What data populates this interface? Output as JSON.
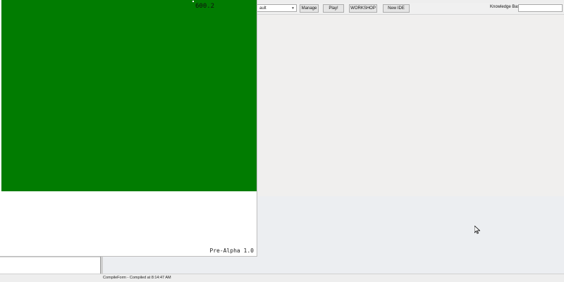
{
  "toolbar": {
    "combo_value": "ault",
    "manage_label": "Manage",
    "play_label": "Play!",
    "workshop_label": "WORKSHOP",
    "new_ide_label": "New IDE",
    "kb_label": "Knowledge Base:",
    "kb_value": ""
  },
  "game": {
    "score": "600.2",
    "version": "Pre-Alpha 1.0",
    "canvas_color": "#017c01"
  },
  "status": {
    "text": "CompileForm - Compiled at 8:14:47 AM"
  },
  "icons": {
    "cursor": "mouse-pointer-icon",
    "combo_arrow": "chevron-down-icon"
  }
}
